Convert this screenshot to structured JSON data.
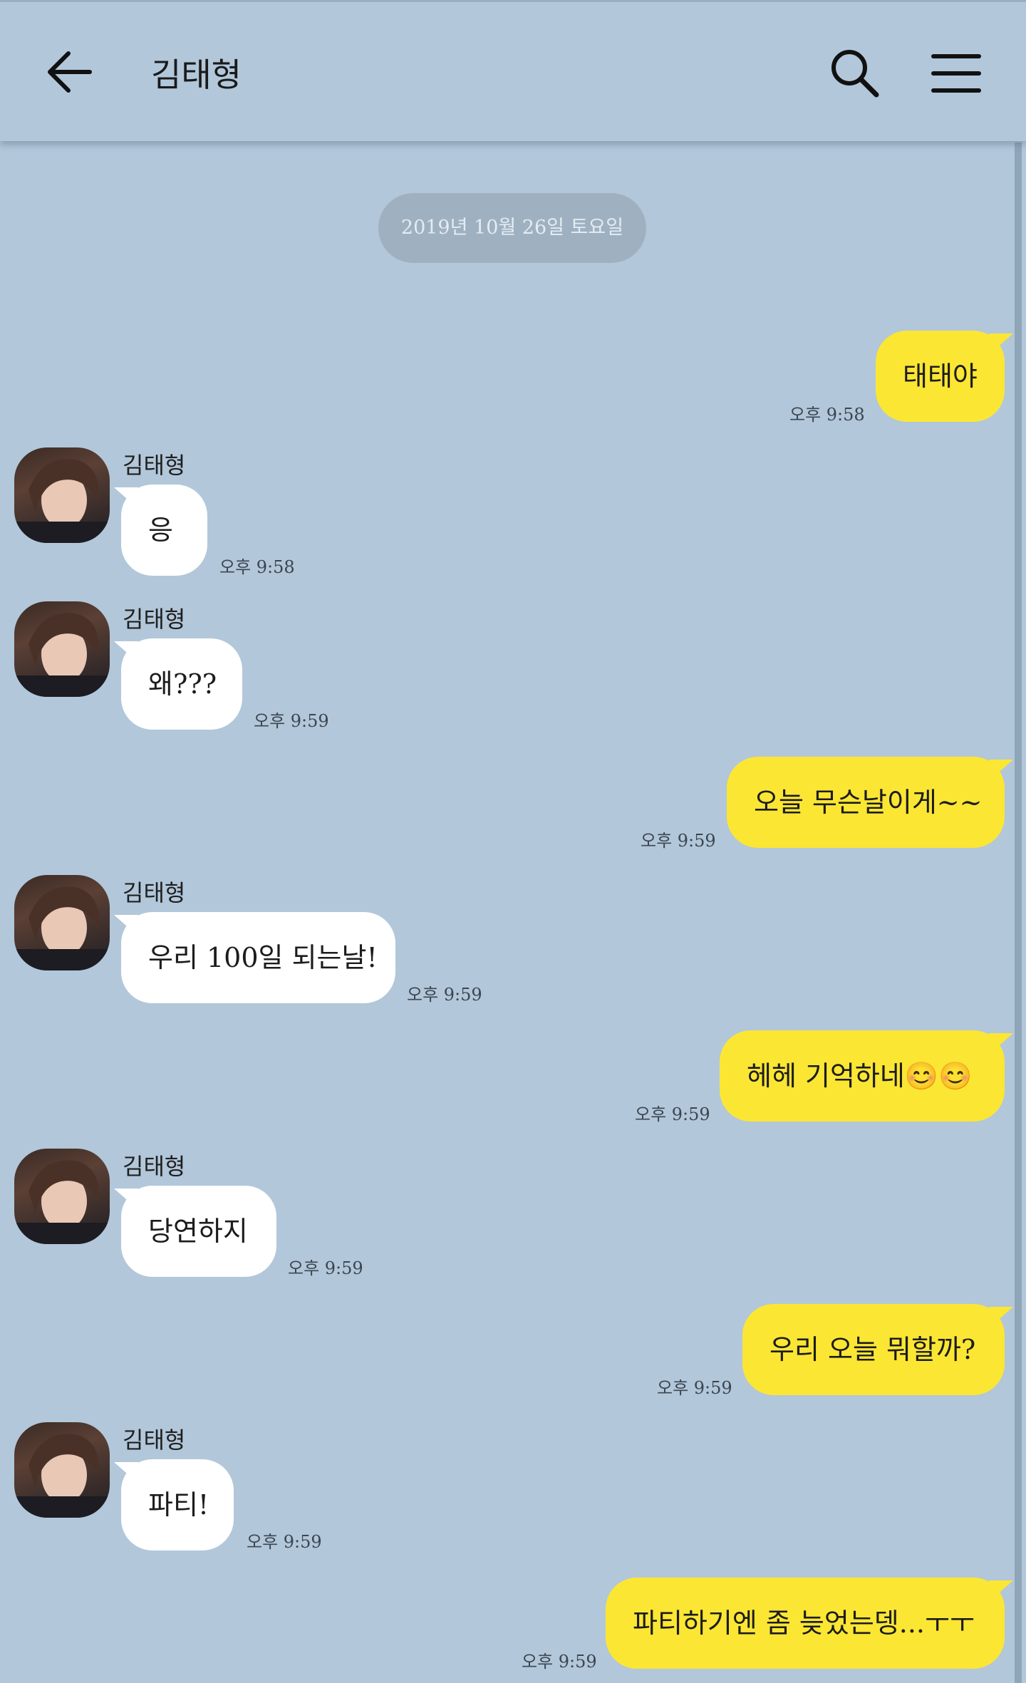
{
  "header": {
    "title": "김태형",
    "back_icon": "arrow-left-icon",
    "search_icon": "search-icon",
    "menu_icon": "hamburger-menu-icon"
  },
  "date_divider": "2019년 10월 26일 토요일",
  "colors": {
    "background": "#b2c7da",
    "my_bubble": "#fbe634",
    "their_bubble": "#ffffff"
  },
  "messages": [
    {
      "from": "me",
      "text": "태태야",
      "time": "오후 9:58"
    },
    {
      "from": "them",
      "sender": "김태형",
      "text": "응",
      "time": "오후 9:58"
    },
    {
      "from": "them",
      "sender": "김태형",
      "text": "왜???",
      "time": "오후 9:59"
    },
    {
      "from": "me",
      "text": "오늘 무슨날이게~~",
      "time": "오후 9:59"
    },
    {
      "from": "them",
      "sender": "김태형",
      "text": "우리 100일 되는날!",
      "time": "오후 9:59"
    },
    {
      "from": "me",
      "text": "헤헤 기억하네😊😊",
      "time": "오후 9:59"
    },
    {
      "from": "them",
      "sender": "김태형",
      "text": "당연하지",
      "time": "오후 9:59"
    },
    {
      "from": "me",
      "text": "우리 오늘 뭐할까?",
      "time": "오후 9:59"
    },
    {
      "from": "them",
      "sender": "김태형",
      "text": "파티!",
      "time": "오후 9:59"
    },
    {
      "from": "me",
      "text": "파티하기엔 좀 늦었는뎅...ㅜㅜ",
      "time": "오후 9:59"
    }
  ]
}
